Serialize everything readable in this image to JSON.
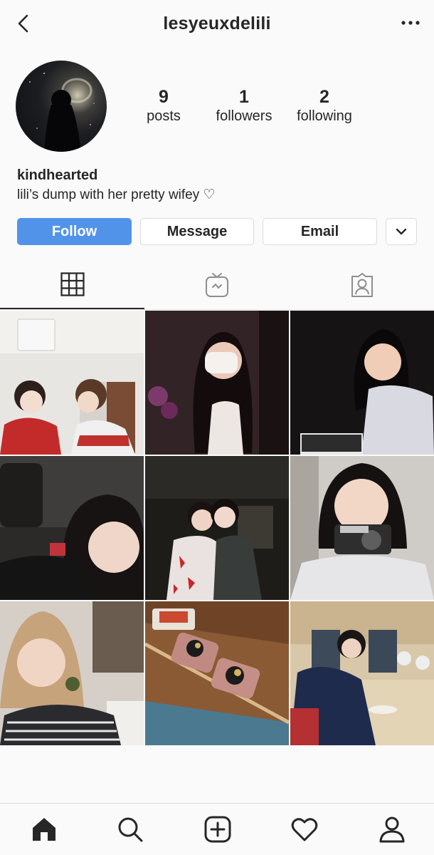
{
  "header": {
    "username": "lesyeuxdelili"
  },
  "stats": [
    {
      "value": "9",
      "label": "posts"
    },
    {
      "value": "1",
      "label": "followers"
    },
    {
      "value": "2",
      "label": "following"
    }
  ],
  "profile": {
    "name": "kindhearted",
    "bio": "lili’s dump with her pretty wifey ♡"
  },
  "actions": {
    "follow": "Follow",
    "message": "Message",
    "email": "Email"
  },
  "colors": {
    "accent": "#5293ea",
    "text": "#262626",
    "background": "#fafafa"
  },
  "tabs": [
    "grid-icon",
    "igtv-icon",
    "tagged-icon"
  ],
  "nav": [
    "home-icon",
    "search-icon",
    "add-post-icon",
    "activity-heart-icon",
    "profile-icon"
  ]
}
